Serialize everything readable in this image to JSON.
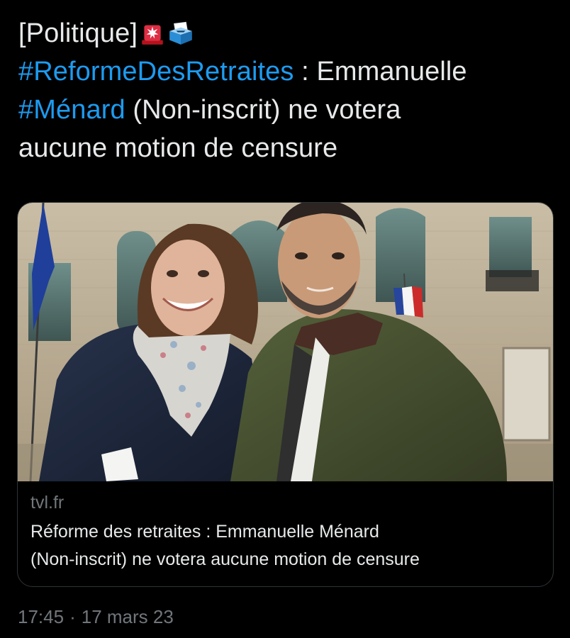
{
  "tweet": {
    "prefix": "[Politique]",
    "emoji_1": "rotating-light-icon",
    "emoji_2": "ballot-box-icon",
    "hashtag_1": "#ReformeDesRetraites",
    "text_1": " : Emmanuelle",
    "hashtag_2": "#Ménard",
    "text_2": " (Non-inscrit) ne votera",
    "text_3": "aucune motion de censure"
  },
  "card": {
    "domain": "tvl.fr",
    "title_line_1": "Réforme des retraites : Emmanuelle Ménard",
    "title_line_2": "(Non-inscrit) ne votera aucune motion de censure"
  },
  "meta": {
    "time": "17:45",
    "separator": "·",
    "date": "17 mars 23"
  },
  "colors": {
    "background": "#000000",
    "text": "#e7e9ea",
    "link": "#1d9bf0",
    "secondary": "#71767b"
  }
}
